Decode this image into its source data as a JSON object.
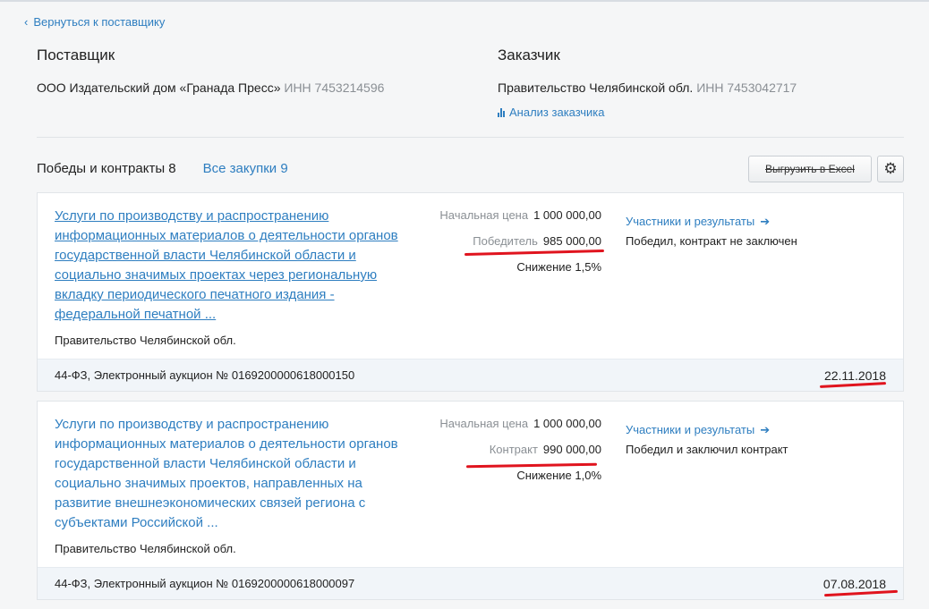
{
  "nav": {
    "back_label": "Вернуться к поставщику"
  },
  "supplier": {
    "heading": "Поставщик",
    "name": "ООО Издательский дом «Гранада Пресс»",
    "inn": "ИНН 7453214596"
  },
  "customer": {
    "heading": "Заказчик",
    "name": "Правительство Челябинской обл.",
    "inn": "ИНН 7453042717",
    "analysis_link": "Анализ заказчика"
  },
  "tabs": {
    "wins_label": "Победы и контракты 8",
    "all_label": "Все закупки 9"
  },
  "toolbar": {
    "excel_label": "Выгрузить в Excel",
    "settings_icon": "gear-icon"
  },
  "accent_color": "#2e7ec0",
  "annotation_color": "#e0141e",
  "cards": [
    {
      "title": "Услуги по производству и распространению информационных материалов о деятельности органов государственной власти Челябинской области и социально значимых проектах через региональную вкладку периодического печатного издания - федеральной печатной ...",
      "customer": "Правительство Челябинской обл.",
      "start_price_label": "Начальная цена",
      "start_price": "1 000 000,00",
      "result_label": "Победитель",
      "result_price": "985 000,00",
      "reduction": "Снижение 1,5%",
      "participants_link": "Участники и результаты",
      "status": "Победил, контракт не заключен",
      "procedure": "44-ФЗ, Электронный аукцион № 0169200000618000150",
      "date": "22.11.2018"
    },
    {
      "title": "Услуги по производству и распространению информационных материалов о деятельности органов государственной власти Челябинской области и социально значимых проектов, направленных на развитие внешнеэкономических связей региона с субъектами Российской ...",
      "customer": "Правительство Челябинской обл.",
      "start_price_label": "Начальная цена",
      "start_price": "1 000 000,00",
      "result_label": "Контракт",
      "result_price": "990 000,00",
      "reduction": "Снижение 1,0%",
      "participants_link": "Участники и результаты",
      "status": "Победил и заключил контракт",
      "procedure": "44-ФЗ, Электронный аукцион № 0169200000618000097",
      "date": "07.08.2018"
    }
  ]
}
